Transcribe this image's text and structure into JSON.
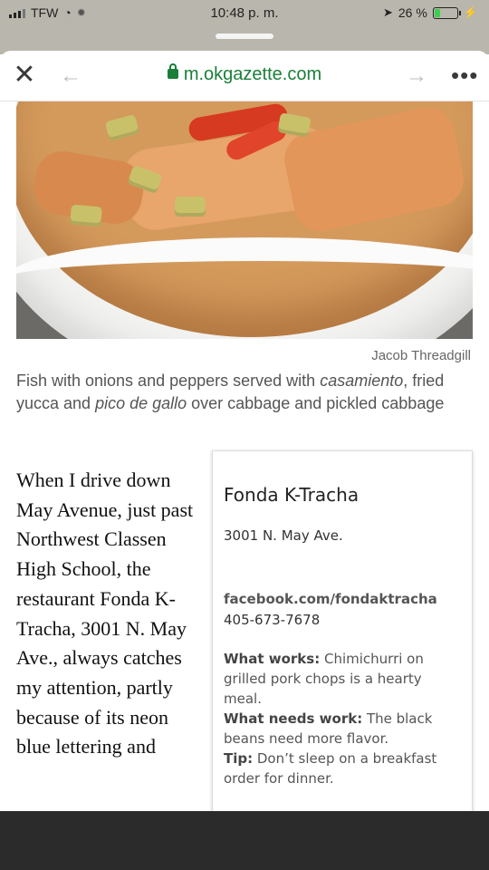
{
  "status_bar": {
    "carrier": "TFW",
    "time": "10:48 p. m.",
    "battery": "26 %",
    "battery_level": 0.26
  },
  "browser": {
    "url": "m.okgazette.com",
    "icons": [
      "close-icon",
      "back-arrow-icon",
      "lock-icon",
      "forward-arrow-icon",
      "more-icon"
    ]
  },
  "article": {
    "photo_credit": "Jacob Threadgill",
    "caption_parts": {
      "p1": "Fish with onions and peppers served with ",
      "em1": "casamiento",
      "p2": ", fried yucca and ",
      "em2": "pico de gallo",
      "p3": " over cabbage and pickled cabbage"
    },
    "body_text": "When I drive down May Avenue, just past Northwest Classen High School,  the restaurant Fonda K-Tracha, 3001 N. May Ave., always catches my attention, partly because of its neon blue lettering and"
  },
  "infobox": {
    "title": "Fonda K-Tracha",
    "address": "3001 N. May Ave.",
    "link": "facebook.com/fondaktracha",
    "phone": "405-673-7678",
    "works_label": "What works:",
    "works_text": " Chimichurri on grilled pork chops is a hearty meal.",
    "needs_label": "What needs work:",
    "needs_text": " The black beans need more flavor.",
    "tip_label": "Tip:",
    "tip_text": " Don’t sleep on a breakfast order for dinner."
  },
  "colors": {
    "url_green": "#1a7f3a",
    "battery_green": "#3ccf4e"
  }
}
